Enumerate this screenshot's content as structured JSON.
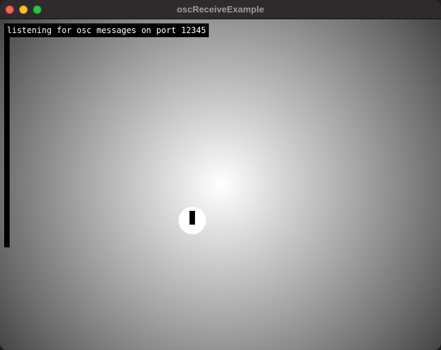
{
  "window": {
    "title": "oscReceiveExample"
  },
  "canvas": {
    "status_message": "listening for osc messages on port 12345"
  },
  "colors": {
    "close": "#fe5f57",
    "minimize": "#febc2e",
    "zoom": "#28c840",
    "titlebar": "#2f2b2c",
    "gradient_center": "#ffffff",
    "gradient_edge": "#000000"
  }
}
